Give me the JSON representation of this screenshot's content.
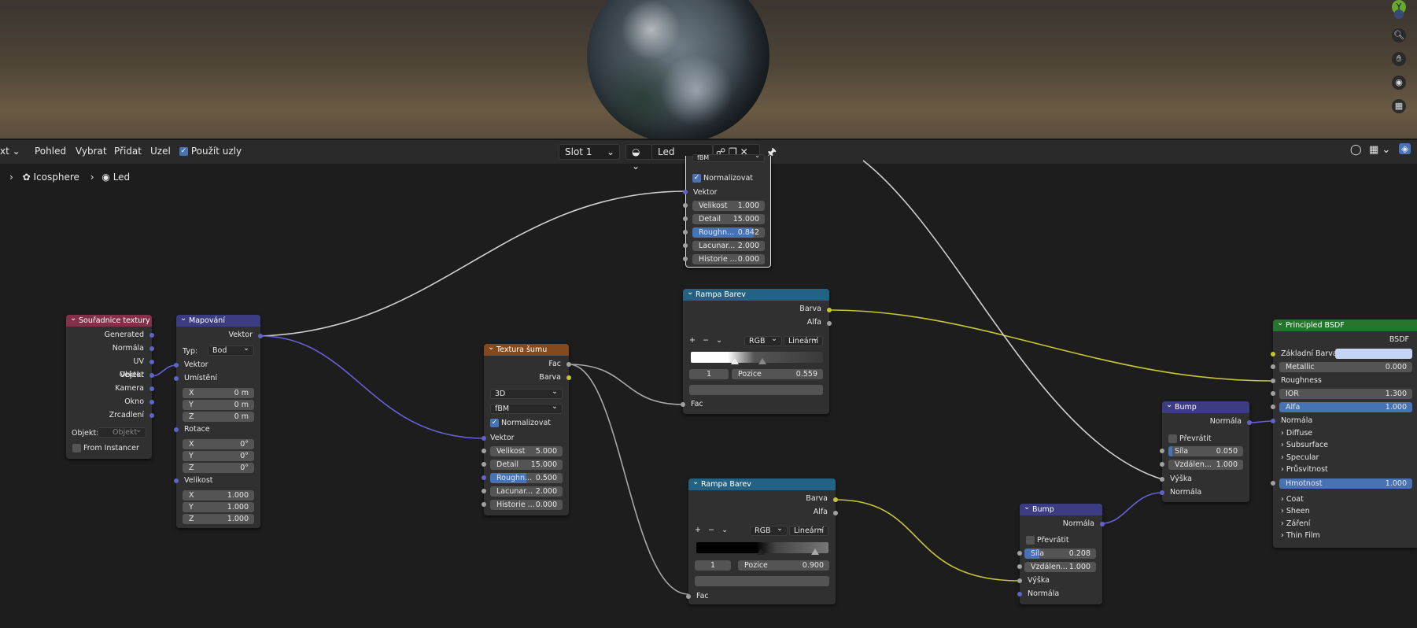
{
  "viewport": {
    "gizmo_label": "Y"
  },
  "toolbar": {
    "menu_cut": "xt",
    "menus": [
      "Pohled",
      "Vybrat",
      "Přidat",
      "Uzel"
    ],
    "use_nodes": "Použít uzly",
    "slot": "Slot 1",
    "material": "Led"
  },
  "breadcrumb": {
    "object": "Icosphere",
    "material": "Led"
  },
  "colors": {
    "header_input": "#83314a",
    "header_vector": "#3c3c83",
    "header_texture": "#83491c",
    "header_converter": "#246283",
    "header_shader": "#27752c",
    "socket_vector": "#6363c7",
    "socket_float": "#a1a1a1",
    "socket_color": "#c7c729",
    "link_vector": "#6a5fd6",
    "link_color": "#c6c63a",
    "link_float": "#a8a8a8"
  },
  "nodes": {
    "tex_coord": {
      "title": "Souřadnice textury",
      "outputs": [
        "Generated",
        "Normála",
        "UV",
        "Vektor",
        "Objekt",
        "Kamera",
        "Okno",
        "Zrcadlení"
      ],
      "object_label": "Objekt:",
      "object_placeholder": "Objekt",
      "from_instancer": "From Instancer"
    },
    "mapping": {
      "title": "Mapování",
      "output": "Vektor",
      "type_label": "Typ:",
      "type_value": "Bod",
      "vector_in": "Vektor",
      "location": "Umístění",
      "rotation": "Rotace",
      "scale": "Velikost",
      "loc": [
        {
          "k": "X",
          "v": "0 m"
        },
        {
          "k": "Y",
          "v": "0 m"
        },
        {
          "k": "Z",
          "v": "0 m"
        }
      ],
      "rot": [
        {
          "k": "X",
          "v": "0°"
        },
        {
          "k": "Y",
          "v": "0°"
        },
        {
          "k": "Z",
          "v": "0°"
        }
      ],
      "scl": [
        {
          "k": "X",
          "v": "1.000"
        },
        {
          "k": "Y",
          "v": "1.000"
        },
        {
          "k": "Z",
          "v": "1.000"
        }
      ]
    },
    "noise_top": {
      "dim": "fBM",
      "normalize": "Normalizovat",
      "vector": "Vektor",
      "fields": [
        {
          "k": "Velikost",
          "v": "1.000"
        },
        {
          "k": "Detail",
          "v": "15.000"
        },
        {
          "k": "Roughn...",
          "v": "0.842",
          "fill": 0.842
        },
        {
          "k": "Lacunar...",
          "v": "2.000"
        },
        {
          "k": "Historie ...",
          "v": "0.000"
        }
      ]
    },
    "noise": {
      "title": "Textura šumu",
      "out_fac": "Fac",
      "out_color": "Barva",
      "dim": "3D",
      "type": "fBM",
      "normalize": "Normalizovat",
      "vector": "Vektor",
      "fields": [
        {
          "k": "Velikost",
          "v": "5.000"
        },
        {
          "k": "Detail",
          "v": "15.000"
        },
        {
          "k": "Roughn...",
          "v": "0.500",
          "fill": 0.5
        },
        {
          "k": "Lacunar...",
          "v": "2.000"
        },
        {
          "k": "Historie ...",
          "v": "0.000"
        }
      ]
    },
    "ramp1": {
      "title": "Rampa Barev",
      "out_color": "Barva",
      "out_alpha": "Alfa",
      "mode": "RGB",
      "interp": "Lineární",
      "index": "1",
      "pos_label": "Pozice",
      "pos_value": "0.559",
      "in_fac": "Fac"
    },
    "ramp2": {
      "title": "Rampa Barev",
      "out_color": "Barva",
      "out_alpha": "Alfa",
      "mode": "RGB",
      "interp": "Lineární",
      "index": "1",
      "pos_label": "Pozice",
      "pos_value": "0.900",
      "in_fac": "Fac"
    },
    "bump1": {
      "title": "Bump",
      "out": "Normála",
      "invert": "Převrátit",
      "strength_label": "Síla",
      "strength_value": "0.208",
      "dist_label": "Vzdálen...",
      "dist_value": "1.000",
      "height": "Výška",
      "normal": "Normála"
    },
    "bump2": {
      "title": "Bump",
      "out": "Normála",
      "invert": "Převrátit",
      "strength_label": "Síla",
      "strength_value": "0.050",
      "dist_label": "Vzdálen...",
      "dist_value": "1.000",
      "height": "Výška",
      "normal": "Normála"
    },
    "bsdf": {
      "title": "Principled BSDF",
      "out": "BSDF",
      "base_color": "Základní Barva",
      "metallic_label": "Metallic",
      "metallic_value": "0.000",
      "roughness": "Roughness",
      "ior_label": "IOR",
      "ior_value": "1.300",
      "alpha_label": "Alfa",
      "alpha_value": "1.000",
      "normal": "Normála",
      "panels": [
        "Diffuse",
        "Subsurface",
        "Specular",
        "Průsvitnost"
      ],
      "weight_label": "Hmotnost",
      "weight_value": "1.000",
      "panels2": [
        "Coat",
        "Sheen",
        "Záření",
        "Thin Film"
      ]
    }
  }
}
